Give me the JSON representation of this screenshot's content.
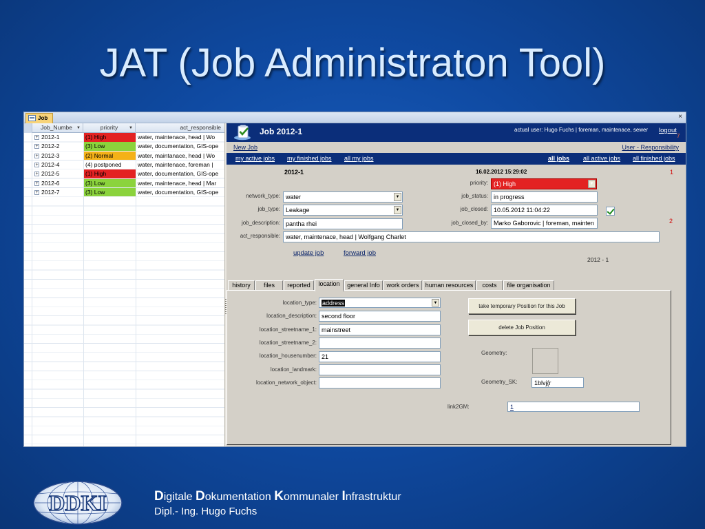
{
  "slide": {
    "title": "JAT (Job Administraton Tool)",
    "footer": {
      "w1_initial": "D",
      "w1_rest": "igitale ",
      "w2_initial": "D",
      "w2_rest": "okumentation ",
      "w3_initial": "K",
      "w3_rest": "ommunaler ",
      "w4_initial": "I",
      "w4_rest": "nfrastruktur",
      "author": "Dipl.- Ing. Hugo Fuchs"
    },
    "logo_text": "DDKI"
  },
  "app": {
    "tab_label": "Job",
    "close_icon": "×",
    "grid": {
      "columns": [
        "Job_Numbe",
        "priority",
        "act_responsible"
      ],
      "rows": [
        {
          "job": "2012-1",
          "priority": "(1) High",
          "prio_color": "#e32222",
          "responsible": "water, maintenace, head | Wo"
        },
        {
          "job": "2012-2",
          "priority": "(3) Low",
          "prio_color": "#8bd33c",
          "responsible": "water, documentation, GIS-ope"
        },
        {
          "job": "2012-3",
          "priority": "(2) Normal",
          "prio_color": "#f5b117",
          "responsible": "water, maintanace, head | Wo"
        },
        {
          "job": "2012-4",
          "priority": "(4) postponed",
          "prio_color": "#ffffff",
          "responsible": "water, maintenace, foreman |"
        },
        {
          "job": "2012-5",
          "priority": "(1) High",
          "prio_color": "#e32222",
          "responsible": "water, documentation, GIS-ope"
        },
        {
          "job": "2012-6",
          "priority": "(3) Low",
          "prio_color": "#8bd33c",
          "responsible": "water, maintenace, head | Mar"
        },
        {
          "job": "2012-7",
          "priority": "(3) Low",
          "prio_color": "#8bd33c",
          "responsible": "water, documentation, GIS-ope"
        }
      ]
    },
    "form": {
      "header": {
        "title": "Job   2012-1",
        "user": "actual user: Hugo Fuchs | foreman, maintenace, sewer",
        "logout": "logout",
        "mark": "7"
      },
      "new_job": "New Job",
      "user_responsibility": "User - Responsibility",
      "nav": {
        "my_active": "my active jobs",
        "my_finished": "my finished jobs",
        "all_my": "all my jobs",
        "all_jobs": "all jobs",
        "all_active": "all active jobs",
        "all_finished": "all finished jobs"
      },
      "job_number": "2012-1",
      "created": "16.02.2012 15:29:02",
      "mark1": "1",
      "mark2": "2",
      "labels": {
        "priority": "priority:",
        "network_type": "network_type:",
        "job_type": "job_type:",
        "job_description": "job_description:",
        "act_responsible": "act_responsible:",
        "job_status": "job_status:",
        "job_closed": "job_closed:",
        "job_closed_by": "job_closed_by:"
      },
      "values": {
        "priority": "(1) High",
        "network_type": "water",
        "job_type": "Leakage",
        "job_description": "pantha rhei",
        "act_responsible": "water, maintenace, head | Wolfgang Charlet",
        "job_status": "in progress",
        "job_closed": "10.05.2012 11:04:22",
        "job_closed_by": "Marko Gaborovic | foreman, mainten"
      },
      "update_job": "update job",
      "forward_job": "forward job",
      "job_counter": "2012  - 1",
      "tabs": [
        "history",
        "files",
        "reported",
        "location",
        "general Info",
        "work orders",
        "human resources",
        "costs",
        "file organisation"
      ],
      "active_tab": "location",
      "location": {
        "labels": {
          "type": "location_type:",
          "description": "location_description:",
          "street1": "location_streetname_1:",
          "street2": "location_streetname_2:",
          "housenumber": "location_housenumber:",
          "landmark": "location_landmark:",
          "network_object": "location_network_object:",
          "geometry": "Geometry:",
          "geometry_sk": "Geometry_SK:",
          "link2gm": "link2GM:"
        },
        "values": {
          "type": "address",
          "description": "second floor",
          "street1": "mainstreet",
          "street2": "",
          "housenumber": "21",
          "landmark": "",
          "network_object": "",
          "geometry_sk": "1blvj{r",
          "link2gm": "1"
        },
        "btn_temp_position": "take temporary Position for this Job",
        "btn_delete_position": "delete Job Position"
      }
    }
  }
}
